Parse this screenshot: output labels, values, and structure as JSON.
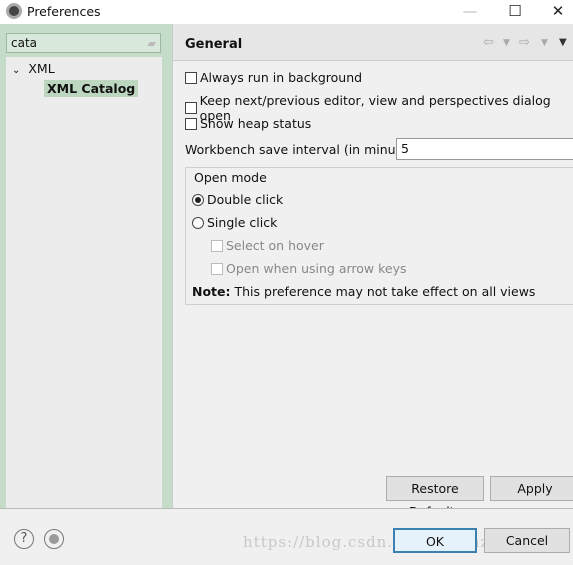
{
  "window": {
    "title": "Preferences",
    "minimize": "—",
    "maximize": "☐",
    "close": "✕"
  },
  "left": {
    "search_value": "cata",
    "tree": [
      {
        "label": "XML",
        "expanded": true
      },
      {
        "label": "XML Catalog",
        "selected": true
      }
    ]
  },
  "page": {
    "title": "General",
    "options": [
      {
        "label": "Always run in background",
        "checked": false
      },
      {
        "label": "Keep next/previous editor, view and perspectives dialog open",
        "checked": false
      },
      {
        "label": "Show heap status",
        "checked": false
      }
    ],
    "save_interval_label": "Workbench save interval (in minutes):",
    "save_interval_value": "5",
    "open_mode": {
      "label": "Open mode",
      "double_click": "Double click",
      "single_click": "Single click",
      "selected": "Double click",
      "select_on_hover": "Select on hover",
      "open_arrow_keys": "Open when using arrow keys"
    },
    "note_label": "Note:",
    "note_text": "This preference may not take effect on all views",
    "restore_defaults": "Restore Defaults",
    "apply": "Apply"
  },
  "footer": {
    "ok": "OK",
    "cancel": "Cancel",
    "help": "?",
    "watermark": "https://blog.csdn.net/dreamzuora"
  }
}
